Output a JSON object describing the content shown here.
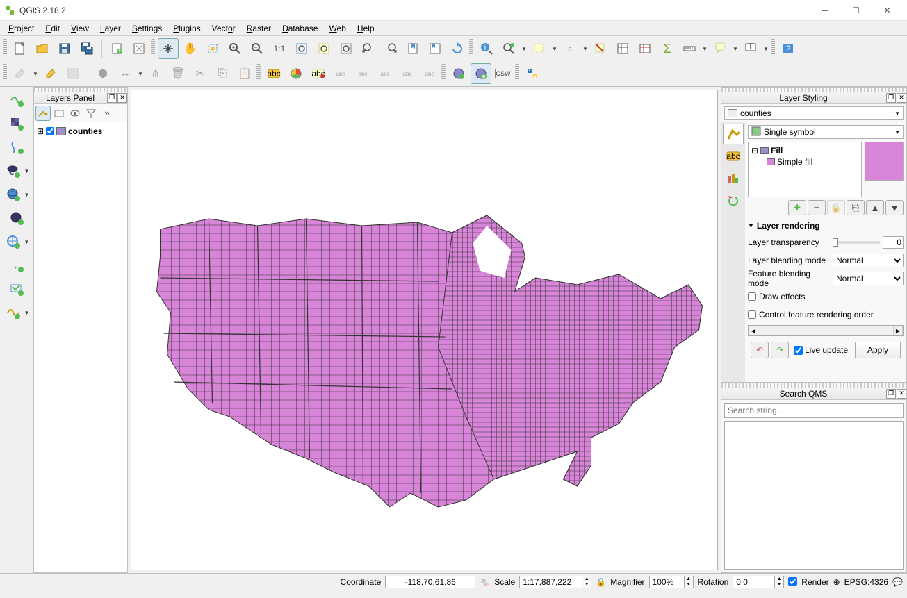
{
  "app": {
    "title": "QGIS 2.18.2"
  },
  "menu": [
    "Project",
    "Edit",
    "View",
    "Layer",
    "Settings",
    "Plugins",
    "Vector",
    "Raster",
    "Database",
    "Web",
    "Help"
  ],
  "layers_panel": {
    "title": "Layers Panel",
    "layer": {
      "name": "counties",
      "visible": true
    }
  },
  "layer_styling": {
    "title": "Layer Styling",
    "selected_layer": "counties",
    "renderer": "Single symbol",
    "fill_label": "Fill",
    "simple_fill_label": "Simple fill",
    "fill_color": "#d884d8",
    "section_rendering": "Layer rendering",
    "transparency_label": "Layer transparency",
    "transparency_value": "0",
    "layer_blending_label": "Layer blending mode",
    "layer_blending_value": "Normal",
    "feature_blending_label": "Feature blending mode",
    "feature_blending_value": "Normal",
    "draw_effects_label": "Draw effects",
    "control_order_label": "Control feature rendering order",
    "live_update_label": "Live update",
    "apply_label": "Apply"
  },
  "search_qms": {
    "title": "Search QMS",
    "placeholder": "Search string..."
  },
  "statusbar": {
    "coord_label": "Coordinate",
    "coord_value": "-118.70,61.86",
    "scale_label": "Scale",
    "scale_value": "1:17,887,222",
    "magnifier_label": "Magnifier",
    "magnifier_value": "100%",
    "rotation_label": "Rotation",
    "rotation_value": "0.0",
    "render_label": "Render",
    "crs_label": "EPSG:4326"
  }
}
